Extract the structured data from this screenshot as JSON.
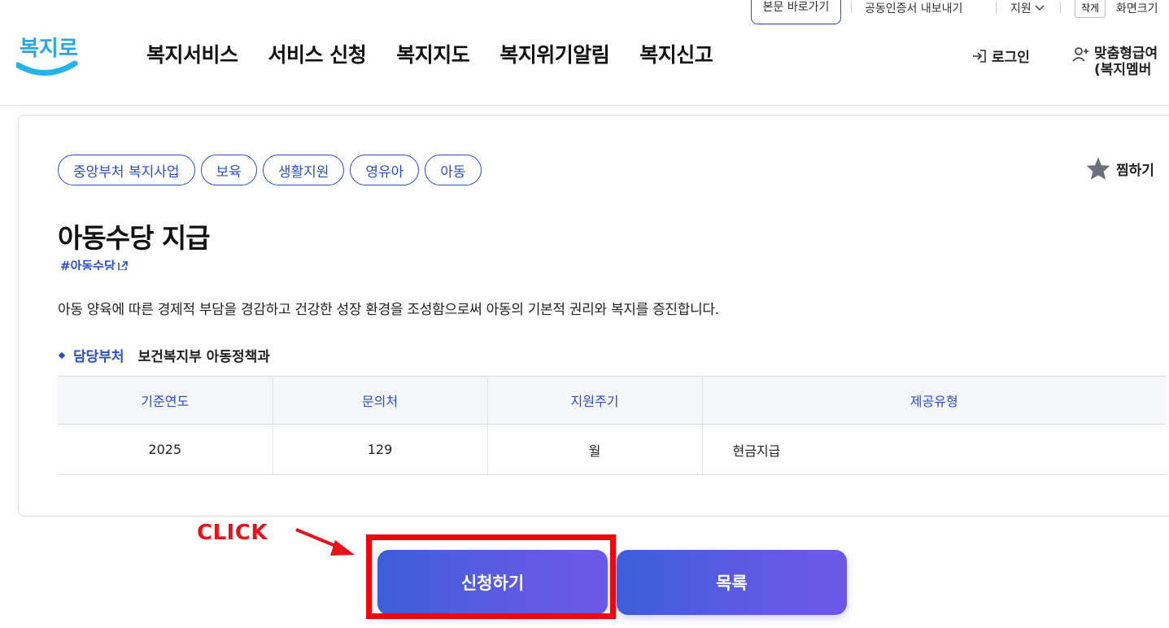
{
  "utility": {
    "skip_link": "본문 바로가기",
    "cert": "공동인증서 내보내기",
    "support": "지원",
    "font_small": "작게",
    "font_size": "화면크기"
  },
  "header": {
    "logo_text": "복지로",
    "nav": [
      "복지서비스",
      "서비스 신청",
      "복지지도",
      "복지위기알림",
      "복지신고"
    ],
    "login": "로그인",
    "custom_line1": "맞춤형급여",
    "custom_line2": "(복지멤버"
  },
  "detail": {
    "tags": [
      "중앙부처 복지사업",
      "보육",
      "생활지원",
      "영유아",
      "아동"
    ],
    "favorite": "찜하기",
    "title": "아동수당 지급",
    "hashtag": "#아동수당",
    "description": "아동 양육에 따른 경제적 부담을 경감하고 건강한 성장 환경을 조성함으로써 아동의 기본적 권리와 복지를 증진합니다.",
    "dept_label": "담당부처",
    "dept_value": "보건복지부 아동정책과",
    "table": {
      "headers": [
        "기준연도",
        "문의처",
        "지원주기",
        "제공유형"
      ],
      "row": [
        "2025",
        "129",
        "월",
        "현금지급"
      ]
    }
  },
  "annotation": {
    "click_label": "CLICK"
  },
  "actions": {
    "apply": "신청하기",
    "list": "목록"
  },
  "colors": {
    "accent": "#2b4fc9",
    "button_start": "#3b5fd9",
    "button_end": "#6d58e8",
    "highlight": "#f0070c"
  }
}
